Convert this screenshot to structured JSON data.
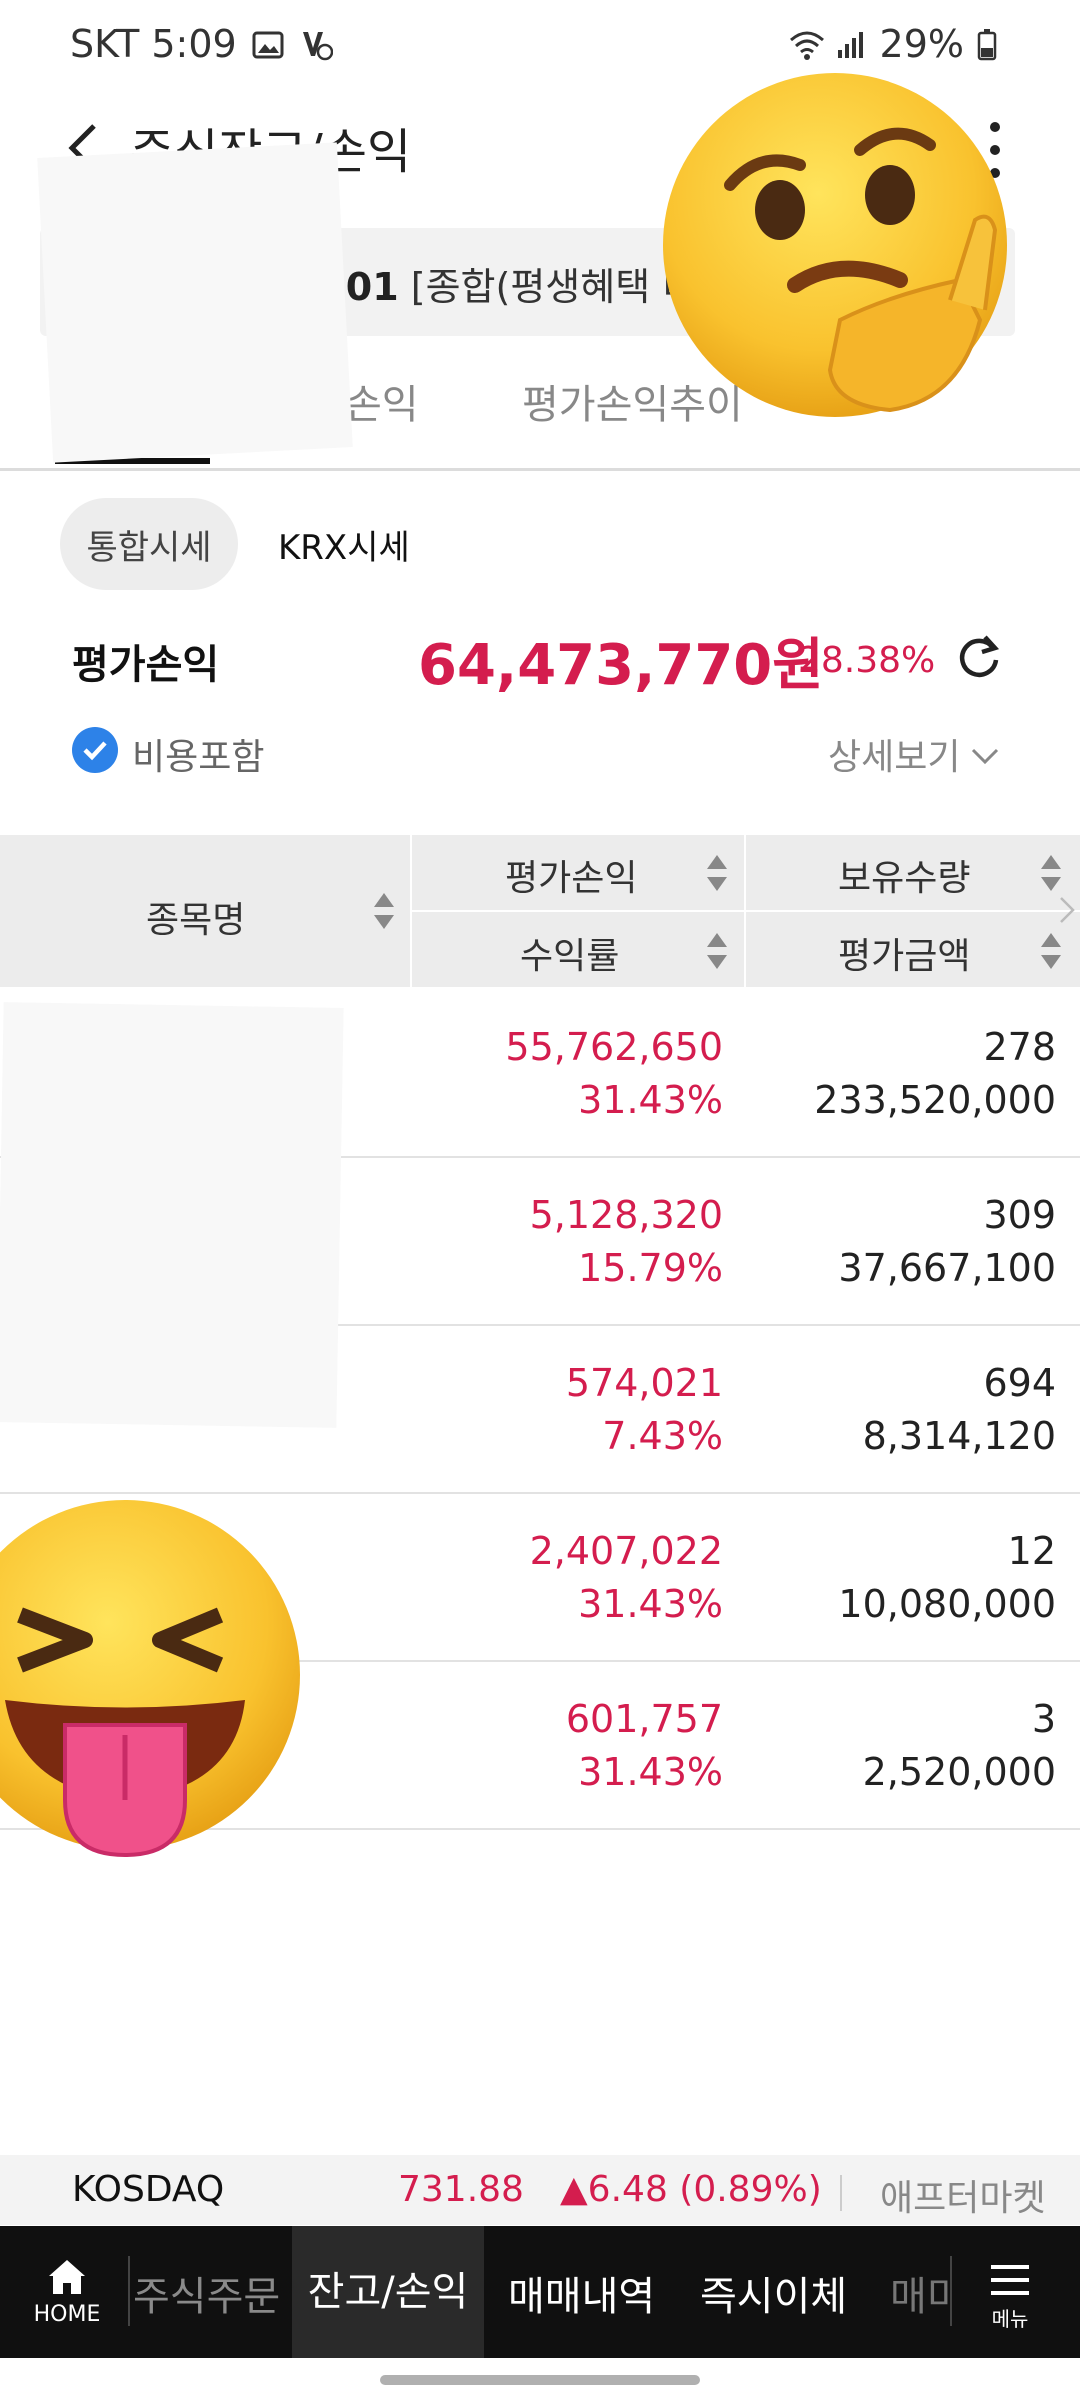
{
  "status_bar": {
    "time": "SKT 5:09",
    "battery": "29%"
  },
  "header": {
    "title": "주식잔고/손익"
  },
  "account": {
    "number": "-01",
    "type": "[종합(평생혜택 비"
  },
  "tabs": [
    {
      "label": "주",
      "active": true
    },
    {
      "label": "손익",
      "active": false
    },
    {
      "label": "평가손익추이",
      "active": false
    }
  ],
  "price_source": {
    "selected": "통합시세",
    "other": "KRX시세"
  },
  "summary": {
    "label": "평가손익",
    "value": "64,473,770원",
    "rate": "28.38%",
    "include_fee_label": "비용포함",
    "detail_label": "상세보기"
  },
  "table": {
    "headers": {
      "name": "종목명",
      "pl": "평가손익",
      "rate": "수익률",
      "qty": "보유수량",
      "eval": "평가금액"
    },
    "rows": [
      {
        "pl": "55,762,650",
        "rate": "31.43%",
        "qty": "278",
        "eval": "233,520,000"
      },
      {
        "pl": "5,128,320",
        "rate": "15.79%",
        "qty": "309",
        "eval": "37,667,100"
      },
      {
        "pl": "574,021",
        "rate": "7.43%",
        "qty": "694",
        "eval": "8,314,120"
      },
      {
        "pl": "2,407,022",
        "rate": "31.43%",
        "qty": "12",
        "eval": "10,080,000"
      },
      {
        "pl": "601,757",
        "rate": "31.43%",
        "qty": "3",
        "eval": "2,520,000"
      }
    ]
  },
  "ticker": {
    "name": "KOSDAQ",
    "value": "731.88",
    "change": "▲6.48 (0.89%)",
    "after_market": "애프터마켓"
  },
  "bottom_nav": {
    "home": "HOME",
    "items": [
      "주식주문",
      "잔고/손익",
      "매매내역",
      "즉시이체",
      "매미"
    ],
    "menu": "메뉴"
  },
  "colors": {
    "accent_red": "#d41d4e",
    "check_blue": "#2d82e8",
    "nav_bg": "#101010"
  }
}
